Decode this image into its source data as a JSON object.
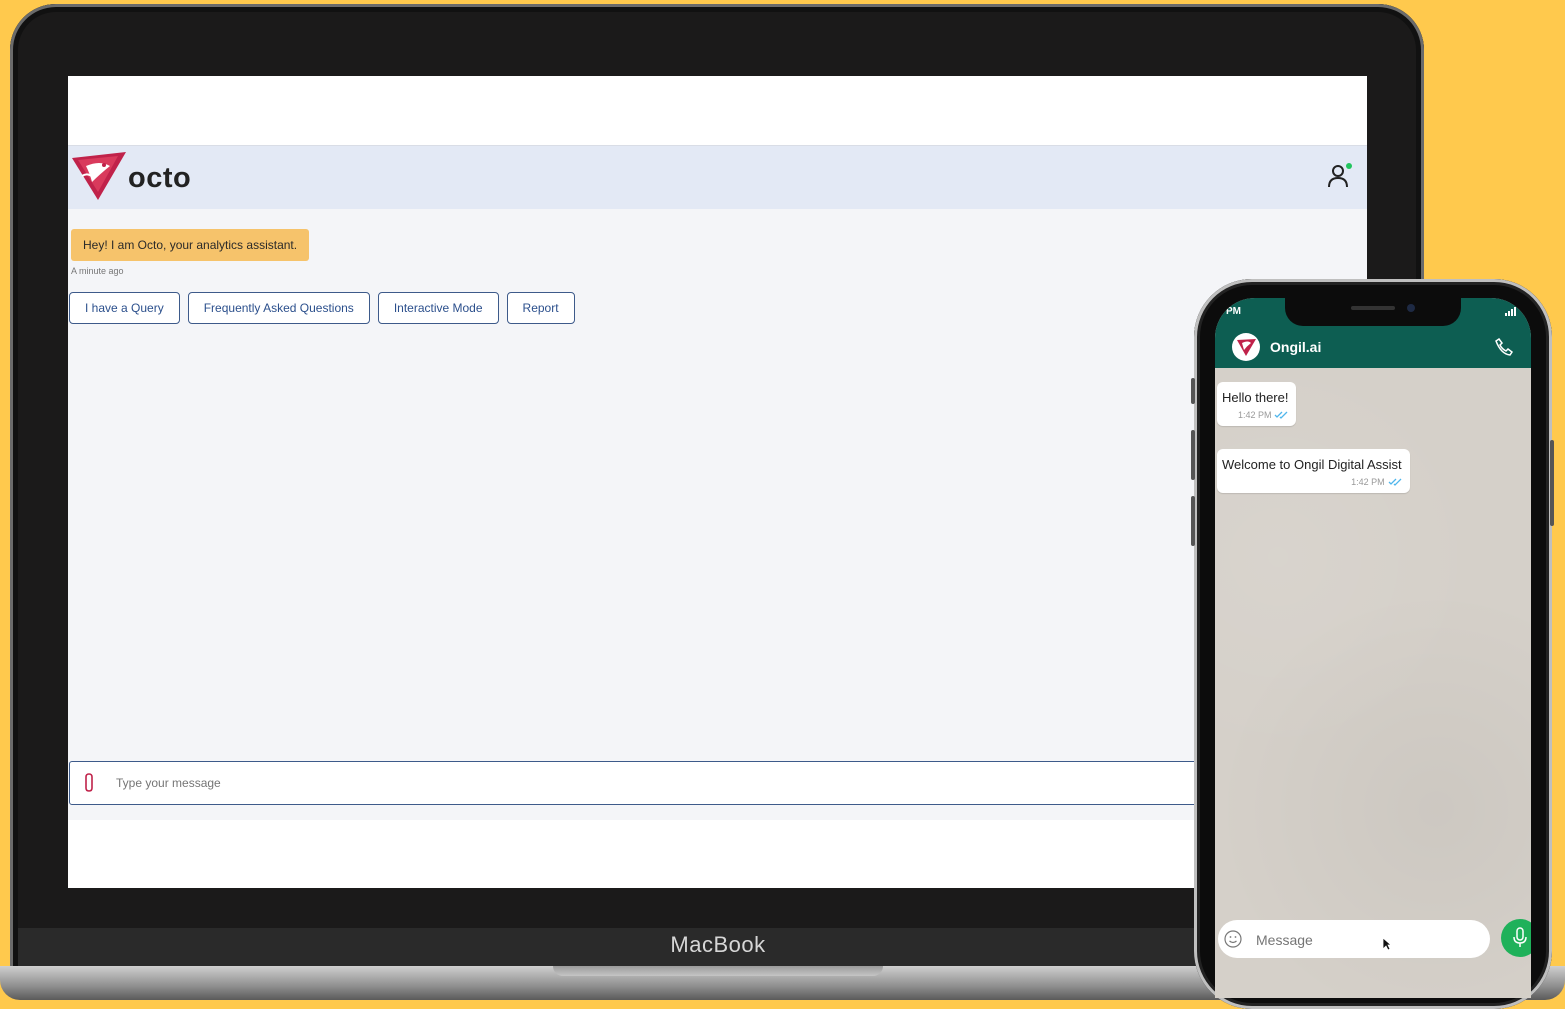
{
  "device_label": "MacBook",
  "octo_app": {
    "brand_name": "octo",
    "bot_message": "Hey! I am Octo, your analytics assistant.",
    "bot_message_time": "A minute ago",
    "quick_replies": [
      {
        "label": "I have a Query"
      },
      {
        "label": "Frequently Asked Questions"
      },
      {
        "label": "Interactive Mode"
      },
      {
        "label": "Report"
      }
    ],
    "composer_placeholder": "Type your message",
    "colors": {
      "header_bg": "#e3e9f5",
      "bot_bubble": "#f6c36b",
      "accent": "#2b4f8c",
      "status_online": "#22c55e"
    }
  },
  "whatsapp": {
    "status_time": "PM",
    "contact_name": "Ongil.ai",
    "messages": [
      {
        "text": "Hello there!",
        "time": "1:42 PM"
      },
      {
        "text": "Welcome to Ongil Digital Assist",
        "time": "1:42 PM"
      }
    ],
    "composer_placeholder": "Message",
    "colors": {
      "header_bg": "#0d5e52",
      "mic_button": "#1fb15a"
    }
  },
  "icons": [
    "octo-logo-icon",
    "user-icon",
    "paperclip-icon",
    "signal-icon",
    "phone-call-icon",
    "double-check-icon",
    "emoji-icon",
    "mic-icon",
    "mouse-cursor-icon"
  ]
}
